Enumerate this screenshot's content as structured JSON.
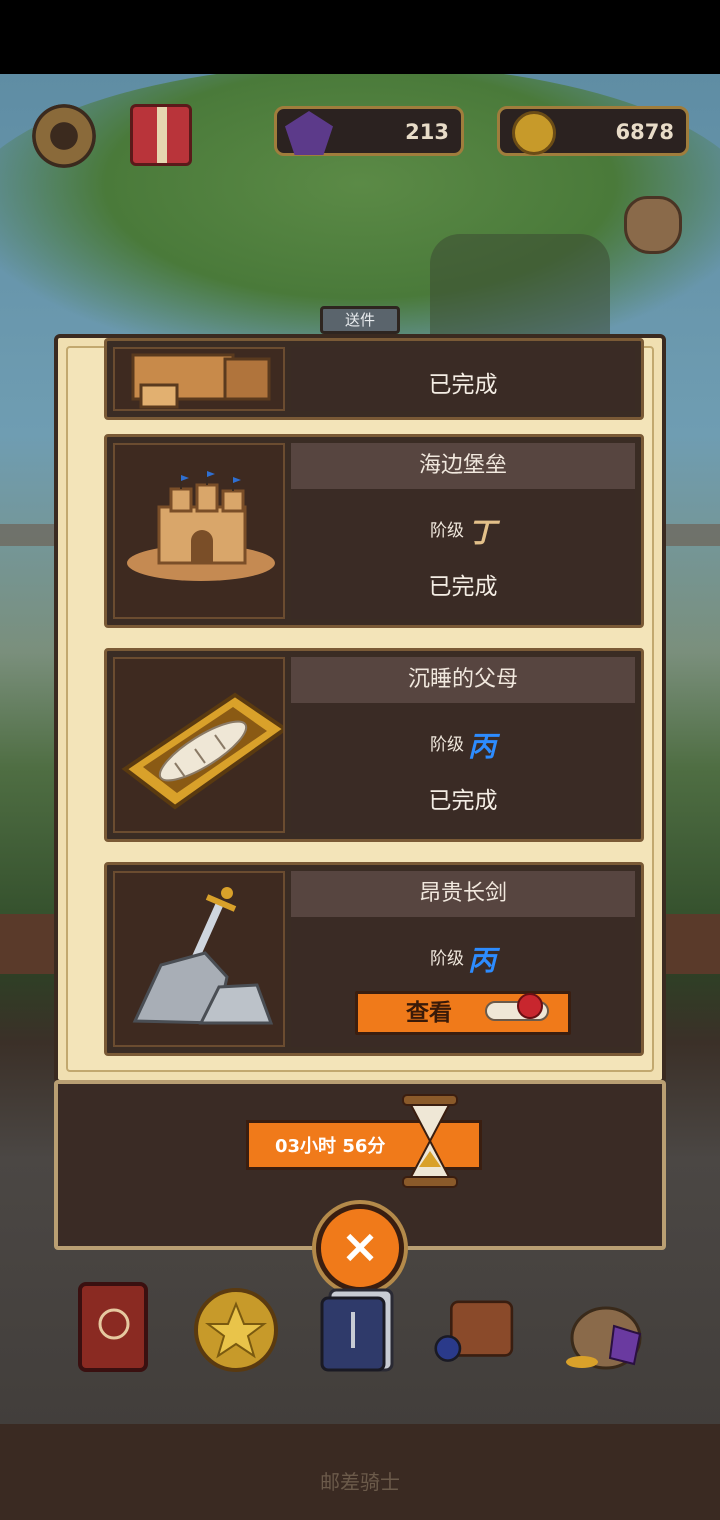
{
  "screen": "送件",
  "resources": {
    "gems": "213",
    "coins": "6878"
  },
  "tab_label": "送件",
  "quests": [
    {
      "title": "",
      "status": "已完成"
    },
    {
      "title": "海边堡垒",
      "grade_label": "阶级",
      "grade": "丁",
      "status": "已完成"
    },
    {
      "title": "沉睡的父母",
      "grade_label": "阶级",
      "grade": "丙",
      "status": "已完成"
    },
    {
      "title": "昂贵长剑",
      "grade_label": "阶级",
      "grade": "丙",
      "action_label": "查看"
    }
  ],
  "timer": "03小时 56分",
  "close_label": "×",
  "footer": "邮差骑士",
  "colors": {
    "accent_orange": "#f07a1a",
    "grade_ding": "#e3c08a",
    "grade_bing": "#2d8cff"
  }
}
